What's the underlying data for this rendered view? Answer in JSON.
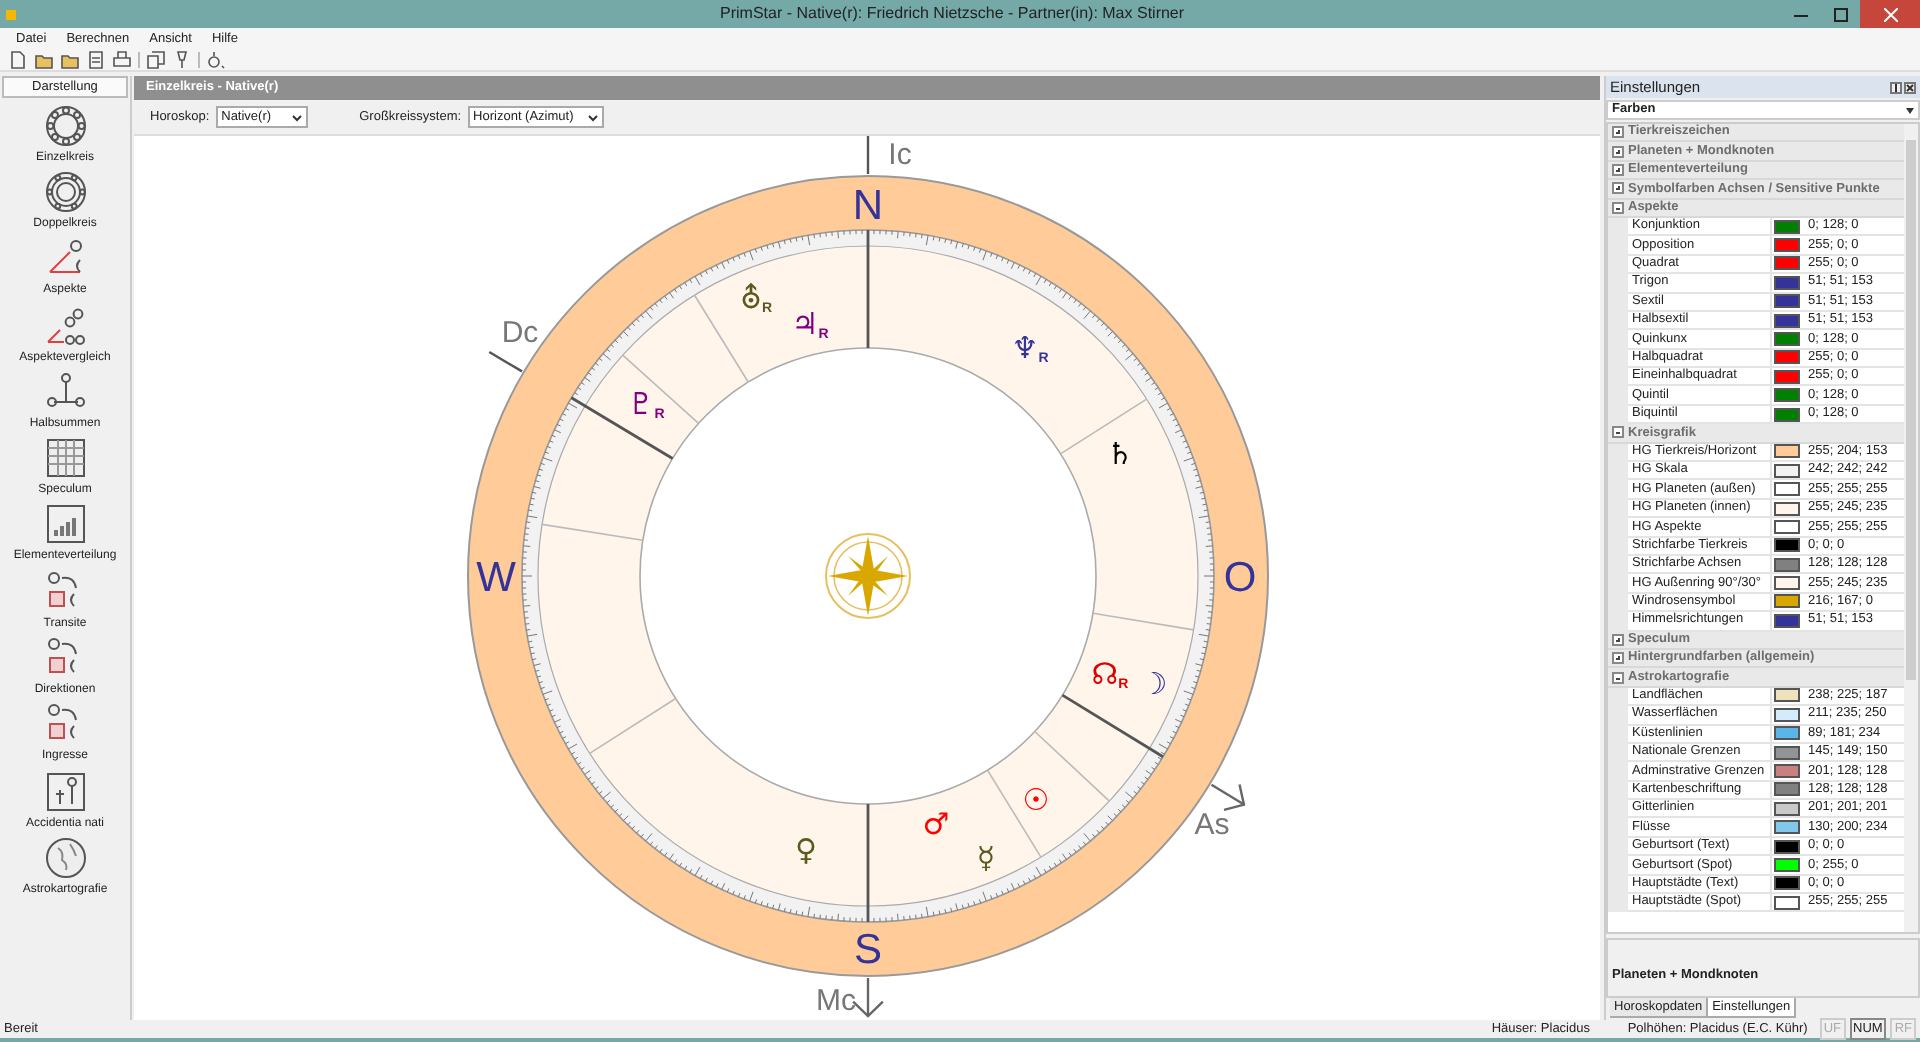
{
  "window": {
    "title": "PrimStar - Native(r): Friedrich Nietzsche - Partner(in): Max Stirner"
  },
  "menu": [
    "Datei",
    "Berechnen",
    "Ansicht",
    "Hilfe"
  ],
  "sidebar": {
    "title": "Darstellung",
    "items": [
      {
        "label": "Einzelkreis",
        "kind": "ring"
      },
      {
        "label": "Doppelkreis",
        "kind": "double"
      },
      {
        "label": "Aspekte",
        "kind": "aspect"
      },
      {
        "label": "Aspektevergleich",
        "kind": "compare"
      },
      {
        "label": "Halbsummen",
        "kind": "midpoint"
      },
      {
        "label": "Speculum",
        "kind": "grid"
      },
      {
        "label": "Elementeverteilung",
        "kind": "bars"
      },
      {
        "label": "Transite",
        "kind": "transit"
      },
      {
        "label": "Direktionen",
        "kind": "direction"
      },
      {
        "label": "Ingresse",
        "kind": "ingress"
      },
      {
        "label": "Accidentia nati",
        "kind": "accident"
      },
      {
        "label": "Astrokartografie",
        "kind": "globe"
      }
    ]
  },
  "document": {
    "title": "Einzelkreis - Native(r)",
    "options": [
      {
        "label": "Horoskop:",
        "value": "Native(r)"
      },
      {
        "label": "Großkreissystem:",
        "value": "Horizont (Azimut)"
      }
    ]
  },
  "chart": {
    "directions": [
      "N",
      "O",
      "S",
      "W"
    ],
    "axes": [
      {
        "label": "Ic",
        "kind": "line"
      },
      {
        "label": "Dc",
        "kind": "line"
      },
      {
        "label": "As",
        "kind": "arrow"
      },
      {
        "label": "Mc",
        "kind": "arrow"
      }
    ],
    "planets": [
      {
        "glyph": "⛢",
        "retro": "R",
        "color": "#5a5a1e"
      },
      {
        "glyph": "♃",
        "retro": "R",
        "color": "#800080"
      },
      {
        "glyph": "♆",
        "retro": "R",
        "color": "#333399"
      },
      {
        "glyph": "♄",
        "color": "#000000"
      },
      {
        "glyph": "♇",
        "retro": "R",
        "color": "#800080"
      },
      {
        "glyph": "☊",
        "retro": "R",
        "color": "#e00000"
      },
      {
        "glyph": "☽",
        "color": "#333399"
      },
      {
        "glyph": "☉",
        "color": "#ff0000"
      },
      {
        "glyph": "♂",
        "color": "#ff0000"
      },
      {
        "glyph": "☿",
        "color": "#5a5a1e"
      },
      {
        "glyph": "♀",
        "color": "#5a5a1e"
      }
    ]
  },
  "settings": {
    "title": "Einstellungen",
    "selector": "Farben",
    "groups": [
      {
        "label": "Tierkreiszeichen",
        "expanded": false
      },
      {
        "label": "Planeten + Mondknoten",
        "expanded": false
      },
      {
        "label": "Elementeverteilung",
        "expanded": false
      },
      {
        "label": "Symbolfarben Achsen / Sensitive Punkte",
        "expanded": false
      },
      {
        "label": "Aspekte",
        "expanded": true,
        "items": [
          {
            "label": "Konjunktion",
            "value": "0; 128; 0",
            "color": "#008000"
          },
          {
            "label": "Opposition",
            "value": "255; 0; 0",
            "color": "#ff0000"
          },
          {
            "label": "Quadrat",
            "value": "255; 0; 0",
            "color": "#ff0000"
          },
          {
            "label": "Trigon",
            "value": "51; 51; 153",
            "color": "#333399"
          },
          {
            "label": "Sextil",
            "value": "51; 51; 153",
            "color": "#333399"
          },
          {
            "label": "Halbsextil",
            "value": "51; 51; 153",
            "color": "#333399"
          },
          {
            "label": "Quinkunx",
            "value": "0; 128; 0",
            "color": "#008000"
          },
          {
            "label": "Halbquadrat",
            "value": "255; 0; 0",
            "color": "#ff0000"
          },
          {
            "label": "Eineinhalbquadrat",
            "value": "255; 0; 0",
            "color": "#ff0000"
          },
          {
            "label": "Quintil",
            "value": "0; 128; 0",
            "color": "#008000"
          },
          {
            "label": "Biquintil",
            "value": "0; 128; 0",
            "color": "#008000"
          }
        ]
      },
      {
        "label": "Kreisgrafik",
        "expanded": true,
        "items": [
          {
            "label": "HG Tierkreis/Horizont",
            "value": "255; 204; 153",
            "color": "#ffcc99"
          },
          {
            "label": "HG Skala",
            "value": "242; 242; 242",
            "color": "#f2f2f2"
          },
          {
            "label": "HG Planeten (außen)",
            "value": "255; 255; 255",
            "color": "#ffffff"
          },
          {
            "label": "HG Planeten (innen)",
            "value": "255; 245; 235",
            "color": "#fff5eb"
          },
          {
            "label": "HG Aspekte",
            "value": "255; 255; 255",
            "color": "#ffffff"
          },
          {
            "label": "Strichfarbe Tierkreis",
            "value": "0; 0; 0",
            "color": "#000000"
          },
          {
            "label": "Strichfarbe Achsen",
            "value": "128; 128; 128",
            "color": "#808080"
          },
          {
            "label": "HG Außenring 90°/30°",
            "value": "255; 245; 235",
            "color": "#fff5eb"
          },
          {
            "label": "Windrosensymbol",
            "value": "216; 167; 0",
            "color": "#d8a700"
          },
          {
            "label": "Himmelsrichtungen",
            "value": "51; 51; 153",
            "color": "#333399"
          }
        ]
      },
      {
        "label": "Speculum",
        "expanded": false
      },
      {
        "label": "Hintergrundfarben (allgemein)",
        "expanded": false
      },
      {
        "label": "Astrokartografie",
        "expanded": true,
        "items": [
          {
            "label": "Landflächen",
            "value": "238; 225; 187",
            "color": "#eee1bb"
          },
          {
            "label": "Wasserflächen",
            "value": "211; 235; 250",
            "color": "#d3ebfa"
          },
          {
            "label": "Küstenlinien",
            "value": "89; 181; 234",
            "color": "#59b5ea"
          },
          {
            "label": "Nationale Grenzen",
            "value": "145; 149; 150",
            "color": "#919596"
          },
          {
            "label": "Adminstrative Grenzen",
            "value": "201; 128; 128",
            "color": "#c98080"
          },
          {
            "label": "Kartenbeschriftung",
            "value": "128; 128; 128",
            "color": "#808080"
          },
          {
            "label": "Gitterlinien",
            "value": "201; 201; 201",
            "color": "#c9c9c9"
          },
          {
            "label": "Flüsse",
            "value": "130; 200; 234",
            "color": "#82c8ea"
          },
          {
            "label": "Geburtsort (Text)",
            "value": "0; 0; 0",
            "color": "#000000"
          },
          {
            "label": "Geburtsort (Spot)",
            "value": "0; 255; 0",
            "color": "#00ff00"
          },
          {
            "label": "Hauptstädte (Text)",
            "value": "0; 0; 0",
            "color": "#000000"
          },
          {
            "label": "Hauptstädte (Spot)",
            "value": "255; 255; 255",
            "color": "#ffffff"
          }
        ]
      }
    ],
    "description": "Planeten + Mondknoten",
    "tabs": [
      {
        "label": "Horoskopdaten",
        "selected": false
      },
      {
        "label": "Einstellungen",
        "selected": true
      }
    ]
  },
  "status_bar": {
    "text": "Bereit",
    "cells": [
      "Häuser: Placidus",
      "Polhöhen: Placidus (E.C. Kühr)"
    ],
    "indicators": [
      {
        "label": "UF",
        "on": false
      },
      {
        "label": "NUM",
        "on": true
      },
      {
        "label": "RF",
        "on": false
      }
    ]
  }
}
